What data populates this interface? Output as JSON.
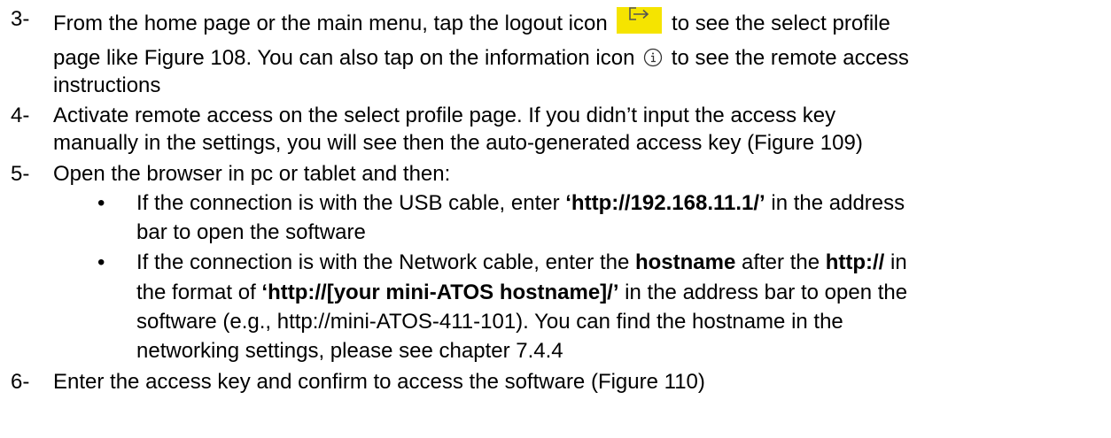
{
  "step3": {
    "num": "3-",
    "line1_pre": "From the home page or the main menu, tap the logout icon",
    "logout_icon": "logout-icon",
    "line1_post": "to see the select profile",
    "line2_pre": "page like Figure 108. You can also tap on the information icon",
    "info_icon": "info-icon",
    "line2_post": "to see the remote access",
    "line3": "instructions",
    "icon_color": "#f5e400"
  },
  "step4": {
    "num": "4-",
    "line1": "Activate remote access on the select profile page. If you didn’t input the access key",
    "line2": "manually in the settings, you will see then the auto-generated access key (Figure 109)"
  },
  "step5": {
    "num": "5-",
    "line1": "Open the browser in pc or tablet and then:",
    "bullet1": {
      "pre": "If the connection is with the USB cable, enter ",
      "bold": "‘http://192.168.11.1/’",
      "post": " in the address",
      "line2": "bar to open the software"
    },
    "bullet2": {
      "l1_pre": "If the connection is with the Network cable, enter the ",
      "l1_bold1": "hostname",
      "l1_mid": " after the ",
      "l1_bold2": "http://",
      "l1_post": " in",
      "l2_pre": "the format of ",
      "l2_bold": "‘http://[your mini-ATOS hostname]/’",
      "l2_post": " in the address bar to open the",
      "l3": "software (e.g., http://mini-ATOS-411-101). You can find the hostname in the",
      "l4": "networking settings, please see chapter 7.4.4"
    }
  },
  "step6": {
    "num": "6-",
    "line1": "Enter the access key and confirm to access the software (Figure 110)"
  }
}
